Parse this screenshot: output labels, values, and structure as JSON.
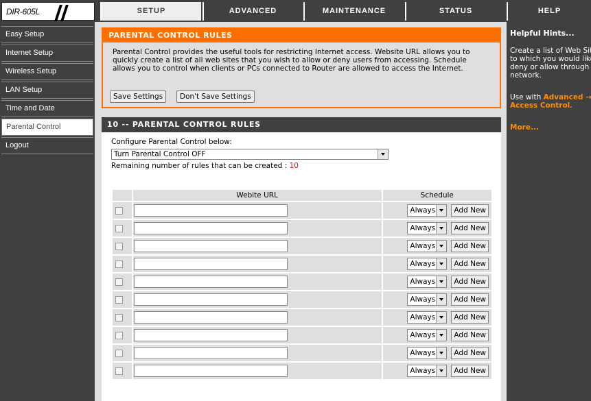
{
  "header": {
    "model": "DIR-605L",
    "tabs": [
      "SETUP",
      "ADVANCED",
      "MAINTENANCE",
      "STATUS",
      "HELP"
    ],
    "active_tab": "SETUP"
  },
  "sidebar": {
    "items": [
      {
        "label": "Easy Setup"
      },
      {
        "label": "Internet Setup"
      },
      {
        "label": "Wireless Setup"
      },
      {
        "label": "LAN Setup"
      },
      {
        "label": "Time and Date"
      },
      {
        "label": "Parental Control"
      },
      {
        "label": "Logout"
      }
    ],
    "active_item": "Parental Control"
  },
  "intro": {
    "title": "PARENTAL CONTROL RULES",
    "description": "Parental Control provides the useful tools for restricting Internet access. Website URL allows you to quickly create a list of all web sites that you wish to allow or deny users from accessing. Schedule allows you to control when clients or PCs connected to Router are allowed to access the Internet.",
    "save_label": "Save Settings",
    "dont_save_label": "Don't Save Settings"
  },
  "rules": {
    "title": "10 -- PARENTAL CONTROL RULES",
    "configure_label": "Configure Parental Control below:",
    "configure_value": "Turn Parental Control OFF",
    "remaining_label": "Remaining number of rules that can be created :",
    "remaining_count": "10",
    "col_url": "Webite URL",
    "col_schedule": "Schedule",
    "schedule_default": "Always",
    "add_new_label": "Add New",
    "row_count": 10
  },
  "hints": {
    "title": "Helpful Hints...",
    "text1": "Create a list of Web Sites to which you would like to deny or allow through the network.",
    "text2_prefix": "Use with",
    "text2_link": "Advanced → Access Control",
    "text2_suffix": ".",
    "more": "More..."
  },
  "colors": {
    "accent": "#ff6f00",
    "dark": "#404040",
    "panel": "#dfdfdf",
    "highlight": "#ff0000"
  }
}
